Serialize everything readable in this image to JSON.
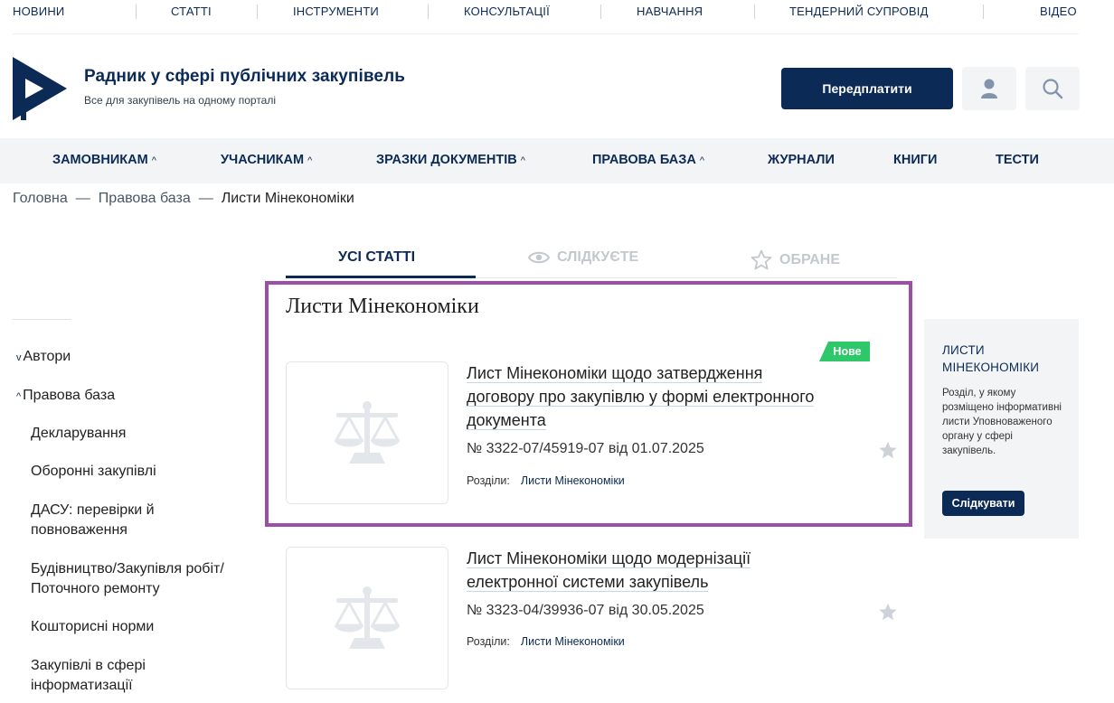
{
  "top_nav": [
    "НОВИНИ",
    "СТАТТІ",
    "ІНСТРУМЕНТИ",
    "КОНСУЛЬТАЦІЇ",
    "НАВЧАННЯ",
    "ТЕНДЕРНИЙ СУПРОВІД",
    "ВІДЕО"
  ],
  "header": {
    "title": "Радник у сфері публічних закупівель",
    "subtitle": "Все для закупівель на одному порталі",
    "subscribe_label": "Передплатити",
    "user_icon": "user-icon",
    "search_icon": "search-icon",
    "brand_color": "#0b2a55"
  },
  "main_nav": [
    "ЗАМОВНИКАМ",
    "УЧАСНИКАМ",
    "ЗРАЗКИ ДОКУМЕНТІВ",
    "ПРАВОВА БАЗА",
    "ЖУРНАЛИ",
    "КНИГИ",
    "ТЕСТИ"
  ],
  "breadcrumb": {
    "home": "Головна",
    "section": "Правова база",
    "current": "Листи Мінекономіки"
  },
  "tabs": {
    "all": "УСІ СТАТТІ",
    "following": "СЛІДКУЄТЕ",
    "favorites": "ОБРАНЕ"
  },
  "sidebar": {
    "authors": "Автори",
    "legal_base": "Правова база",
    "items": [
      "Декларування",
      "Оборонні закупівлі",
      "ДАСУ: перевірки й повноваження",
      "Будівництво/Закупівля робіт/ Поточного ремонту",
      "Кошторисні норми",
      "Закупівлі в сфері інформатизації"
    ]
  },
  "section_title": "Листи Мінекономіки",
  "articles": [
    {
      "title": "Лист Мінекономіки щодо затвердження договору про закупівлю у формі електронного документа",
      "number": "№ 3322-07/45919-07 від 01.07.2025",
      "sections_label": "Розділи:",
      "section": "Листи Мінекономіки",
      "badge": "Нове",
      "badge_color": "#2ec86b"
    },
    {
      "title": "Лист Мінекономіки щодо модернізації електронної системи закупівель",
      "number": "№ 3323-04/39936-07 від 30.05.2025",
      "sections_label": "Розділи:",
      "section": "Листи Мінекономіки"
    }
  ],
  "right_panel": {
    "title": "ЛИСТИ МІНЕКОНОМІКИ",
    "text": "Розділ, у якому розміщено інформативні листи Уповноваженого органу у сфері закупівель.",
    "button": "Слідкувати"
  }
}
